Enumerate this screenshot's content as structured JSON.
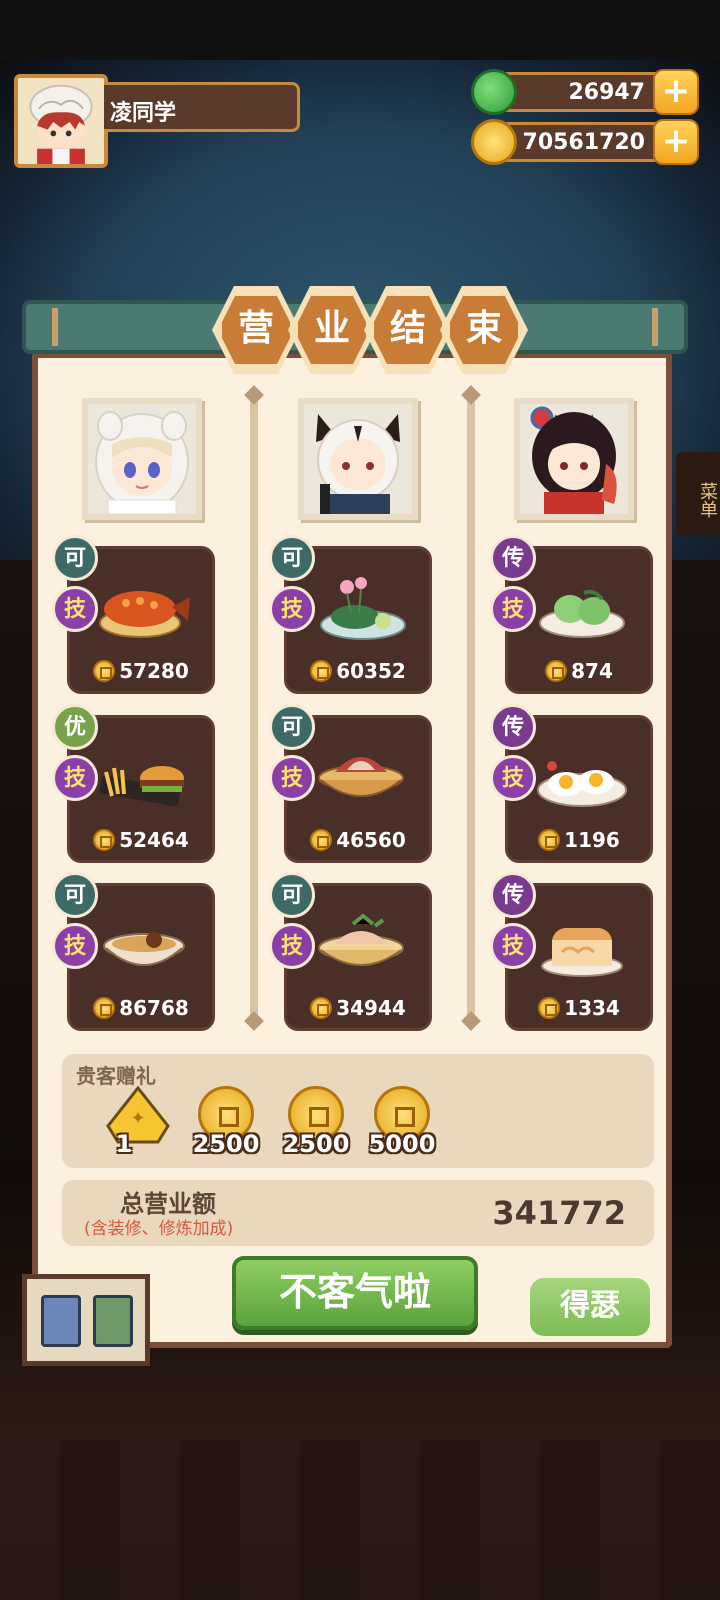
{
  "player": {
    "name": "凌同学"
  },
  "currencies": {
    "jade": {
      "value": "26947",
      "icon": "jade-icon",
      "color": "#3bb04a"
    },
    "gold": {
      "value": "70561720",
      "icon": "gold-coin-icon",
      "color": "#f2b52a"
    }
  },
  "side_tag": "菜单",
  "title_chars": [
    "营",
    "业",
    "结",
    "束"
  ],
  "chefs": [
    {
      "portrait": "chef-white-hood-portrait",
      "dishes": [
        {
          "grade": "可",
          "grade_color": "#3d6a66",
          "skill": "技",
          "price": "57280",
          "icon": "fish-dish-icon"
        },
        {
          "grade": "优",
          "grade_color": "#7aa24a",
          "skill": "技",
          "price": "52464",
          "icon": "burger-fries-icon"
        },
        {
          "grade": "可",
          "grade_color": "#3d6a66",
          "skill": "技",
          "price": "86768",
          "icon": "noodle-pot-icon"
        }
      ]
    },
    {
      "portrait": "chef-white-cat-portrait",
      "dishes": [
        {
          "grade": "可",
          "grade_color": "#3d6a66",
          "skill": "技",
          "price": "60352",
          "icon": "lotus-dish-icon"
        },
        {
          "grade": "可",
          "grade_color": "#3d6a66",
          "skill": "技",
          "price": "46560",
          "icon": "meat-bowl-icon"
        },
        {
          "grade": "可",
          "grade_color": "#3d6a66",
          "skill": "技",
          "price": "34944",
          "icon": "shrimp-bowl-icon"
        }
      ]
    },
    {
      "portrait": "chef-dark-hair-portrait",
      "dishes": [
        {
          "grade": "传",
          "grade_color": "#7a3a8e",
          "skill": "技",
          "price": "874",
          "icon": "green-dumpling-icon"
        },
        {
          "grade": "传",
          "grade_color": "#7a3a8e",
          "skill": "技",
          "price": "1196",
          "icon": "fried-egg-icon"
        },
        {
          "grade": "传",
          "grade_color": "#7a3a8e",
          "skill": "技",
          "price": "1334",
          "icon": "bread-loaf-icon"
        }
      ]
    }
  ],
  "gifts": {
    "title": "贵客赠礼",
    "items": [
      {
        "label": "1",
        "icon": "gold-ticket-icon"
      },
      {
        "label": "2500",
        "icon": "gold-coin-icon"
      },
      {
        "label": "2500",
        "icon": "gold-coin-icon"
      },
      {
        "label": "5000",
        "icon": "gold-coin-icon"
      }
    ]
  },
  "total": {
    "label": "总营业额",
    "sub": "(含装修、修炼加成)",
    "value": "341772"
  },
  "buttons": {
    "confirm": "不客气啦",
    "share": "得瑟"
  }
}
